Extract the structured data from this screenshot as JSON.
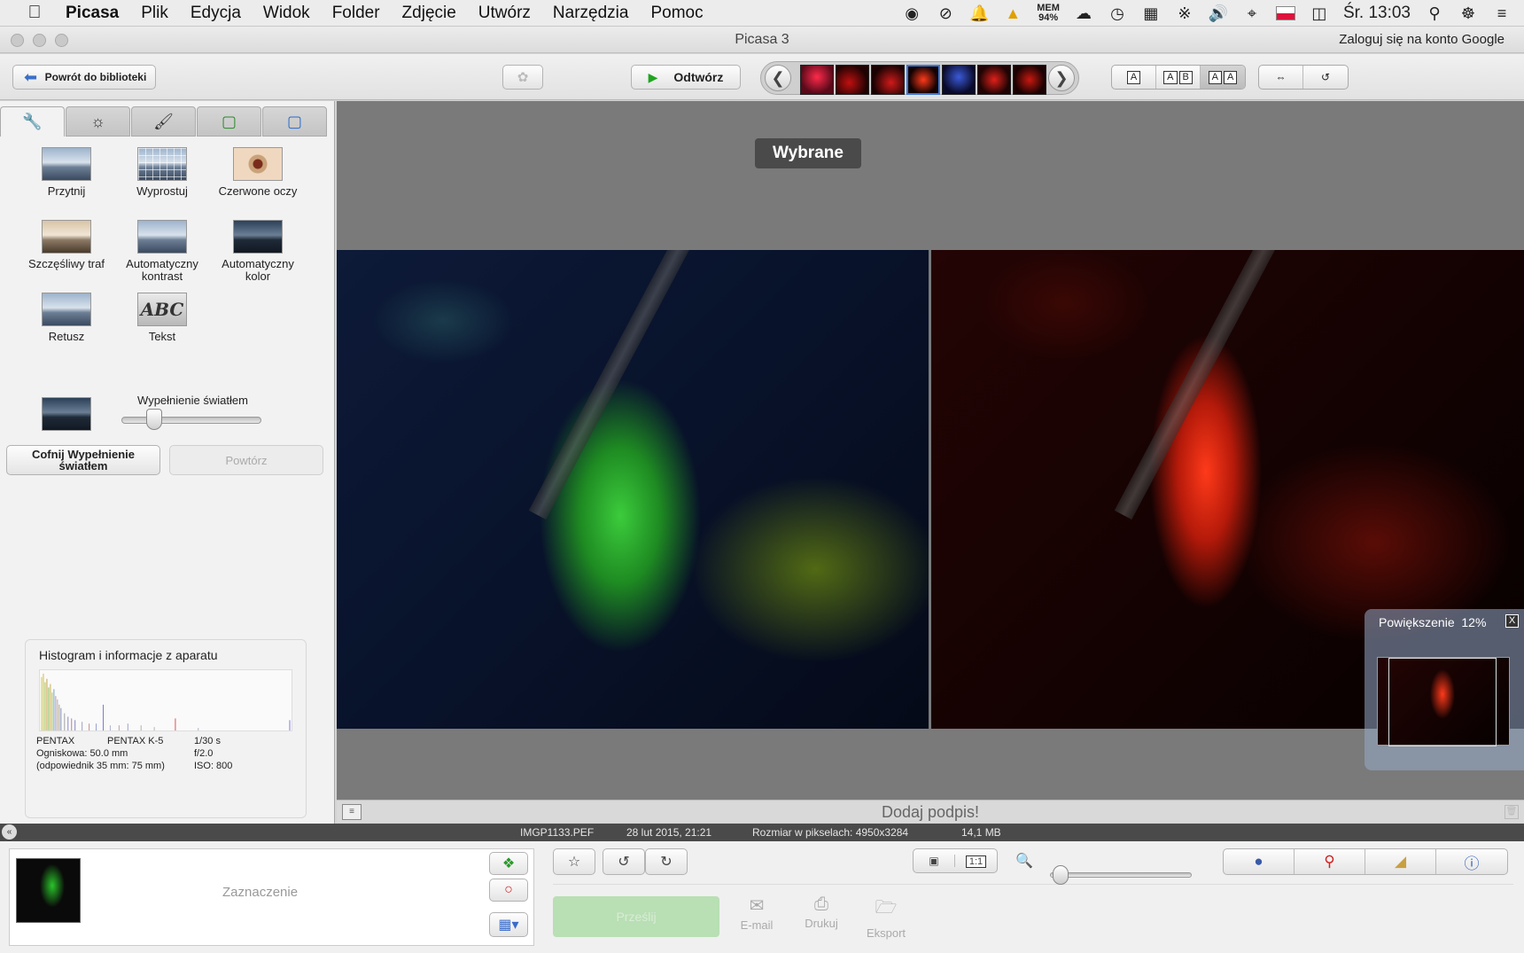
{
  "menubar": {
    "app": "Picasa",
    "items": [
      "Plik",
      "Edycja",
      "Widok",
      "Folder",
      "Zdjęcie",
      "Utwórz",
      "Narzędzia",
      "Pomoc"
    ],
    "mem_label": "MEM",
    "mem_value": "94%",
    "clock": "Śr. 13:03"
  },
  "window": {
    "title": "Picasa 3",
    "login_link": "Zaloguj się na konto Google"
  },
  "toolbar": {
    "back_label": "Powrót do biblioteki",
    "play_label": "Odtwórz",
    "view_single": "A",
    "view_split_a": "A",
    "view_split_b": "B",
    "view_compare_a": "A",
    "view_compare_b": "A"
  },
  "edit_panel": {
    "tools": [
      {
        "label": "Przytnij"
      },
      {
        "label": "Wyprostuj"
      },
      {
        "label": "Czerwone oczy"
      },
      {
        "label": "Szczęśliwy traf"
      },
      {
        "label": "Automatyczny kontrast"
      },
      {
        "label": "Automatyczny kolor"
      },
      {
        "label": "Retusz"
      },
      {
        "label": "Tekst"
      }
    ],
    "text_tool_sample": "ABC",
    "fill_light_label": "Wypełnienie światłem",
    "fill_light_value": 0.2,
    "undo_label": "Cofnij Wypełnienie światłem",
    "redo_label": "Powtórz"
  },
  "histogram": {
    "title": "Histogram i informacje z aparatu",
    "make": "PENTAX",
    "model": "PENTAX K-5",
    "shutter": "1/30 s",
    "focal": "Ogniskowa: 50.0 mm",
    "aperture": "f/2.0",
    "equiv": "(odpowiednik 35 mm:  75 mm)",
    "iso": "ISO: 800"
  },
  "viewer": {
    "badge": "Wybrane",
    "zoom_label": "Powiększenie",
    "zoom_value": "12%",
    "zoom_close": "X",
    "caption_placeholder": "Dodaj podpis!"
  },
  "statusbar": {
    "filename": "IMGP1133.PEF",
    "date": "28 lut 2015, 21:21",
    "pixel_size": "Rozmiar w pikselach: 4950x3284",
    "file_size": "14,1 MB"
  },
  "tray": {
    "selection_label": "Zaznaczenie",
    "upload_label": "Prześlij",
    "email_label": "E-mail",
    "print_label": "Drukuj",
    "export_label": "Eksport",
    "actual_size_label": "1:1",
    "zoom_slider_value": 0.02
  },
  "colors": {
    "accent": "#3c78d8",
    "play_green": "#1fa51f",
    "upload_green": "#b9dfb4"
  }
}
